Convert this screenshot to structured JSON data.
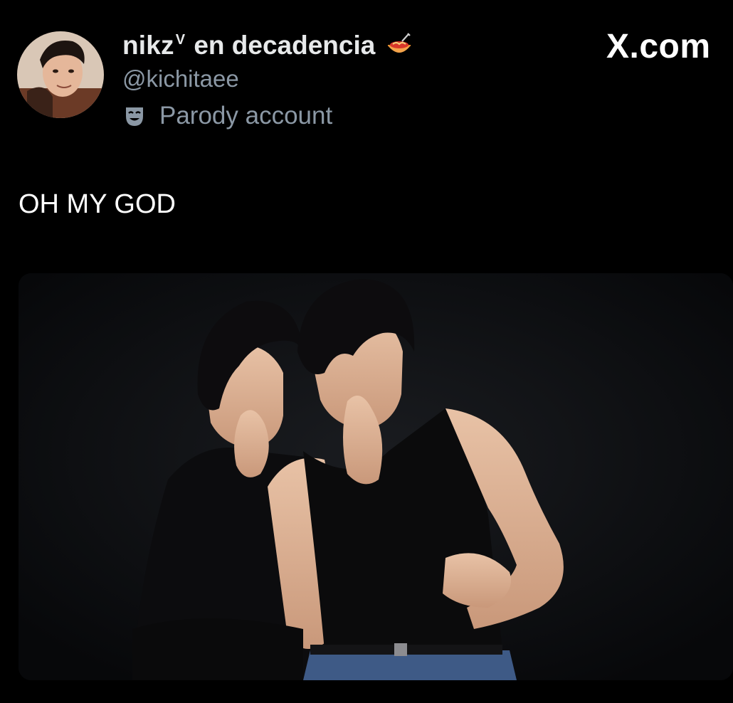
{
  "author": {
    "display_name": "nikz",
    "display_name_sup": "V",
    "display_name_suffix": "en decadencia",
    "name_emoji": "spaghetti-emoji",
    "handle": "@kichitaee",
    "parody_label": "Parody account",
    "parody_icon": "theater-mask-icon"
  },
  "brand": {
    "label": "X.com"
  },
  "tweet": {
    "text": "OH MY GOD"
  },
  "media": {
    "type": "photo"
  },
  "colors": {
    "background": "#000000",
    "primary_text": "#e7e9ea",
    "secondary_text": "#8b98a5",
    "media_background": "#0a0b0d"
  }
}
